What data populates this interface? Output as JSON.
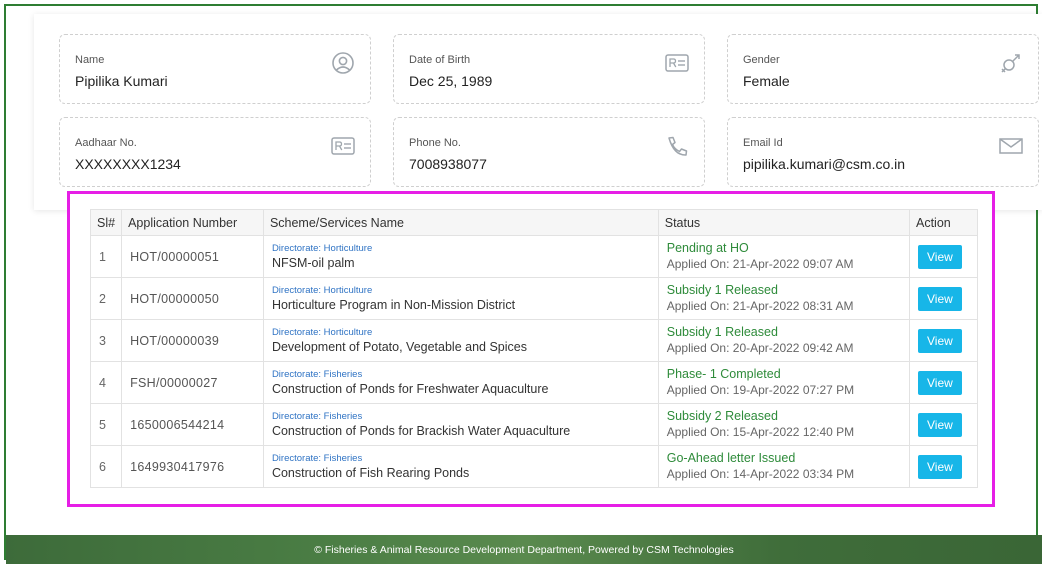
{
  "profile": {
    "name": {
      "label": "Name",
      "value": "Pipilika Kumari",
      "icon": "user-circle-icon"
    },
    "dob": {
      "label": "Date of Birth",
      "value": "Dec 25, 1989",
      "icon": "id-card-icon"
    },
    "gender": {
      "label": "Gender",
      "value": "Female",
      "icon": "gender-icon"
    },
    "aadhaar": {
      "label": "Aadhaar No.",
      "value": "XXXXXXXX1234",
      "icon": "id-card-icon"
    },
    "phone": {
      "label": "Phone No.",
      "value": "7008938077",
      "icon": "phone-icon"
    },
    "email": {
      "label": "Email Id",
      "value": "pipilika.kumari@csm.co.in",
      "icon": "envelope-icon"
    }
  },
  "table": {
    "headers": [
      "Sl#",
      "Application Number",
      "Scheme/Services Name",
      "Status",
      "Action"
    ],
    "rows": [
      {
        "sl": "1",
        "app_no": "HOT/00000051",
        "directorate": "Directorate: Horticulture",
        "scheme": "NFSM-oil palm",
        "status": "Pending at HO",
        "applied": "Applied On: 21-Apr-2022 09:07 AM",
        "action": "View"
      },
      {
        "sl": "2",
        "app_no": "HOT/00000050",
        "directorate": "Directorate: Horticulture",
        "scheme": "Horticulture Program in Non-Mission District",
        "status": "Subsidy 1 Released",
        "applied": "Applied On: 21-Apr-2022 08:31 AM",
        "action": "View"
      },
      {
        "sl": "3",
        "app_no": "HOT/00000039",
        "directorate": "Directorate: Horticulture",
        "scheme": "Development of Potato, Vegetable and Spices",
        "status": "Subsidy 1 Released",
        "applied": "Applied On: 20-Apr-2022 09:42 AM",
        "action": "View"
      },
      {
        "sl": "4",
        "app_no": "FSH/00000027",
        "directorate": "Directorate: Fisheries",
        "scheme": "Construction of Ponds for Freshwater Aquaculture",
        "status": "Phase- 1 Completed",
        "applied": "Applied On: 19-Apr-2022 07:27 PM",
        "action": "View"
      },
      {
        "sl": "5",
        "app_no": "1650006544214",
        "directorate": "Directorate: Fisheries",
        "scheme": "Construction of Ponds for Brackish Water Aquaculture",
        "status": "Subsidy 2 Released",
        "applied": "Applied On: 15-Apr-2022 12:40 PM",
        "action": "View"
      },
      {
        "sl": "6",
        "app_no": "1649930417976",
        "directorate": "Directorate: Fisheries",
        "scheme": "Construction of Fish Rearing Ponds",
        "status": "Go-Ahead letter Issued",
        "applied": "Applied On: 14-Apr-2022 03:34 PM",
        "action": "View"
      }
    ]
  },
  "footer": {
    "text": "© Fisheries & Animal Resource Development Department, Powered by CSM Technologies"
  },
  "colors": {
    "accent": "#17b6e8",
    "status_green": "#2e8b3a",
    "highlight": "#e61ee6",
    "footer_green": "#4a7d44"
  }
}
